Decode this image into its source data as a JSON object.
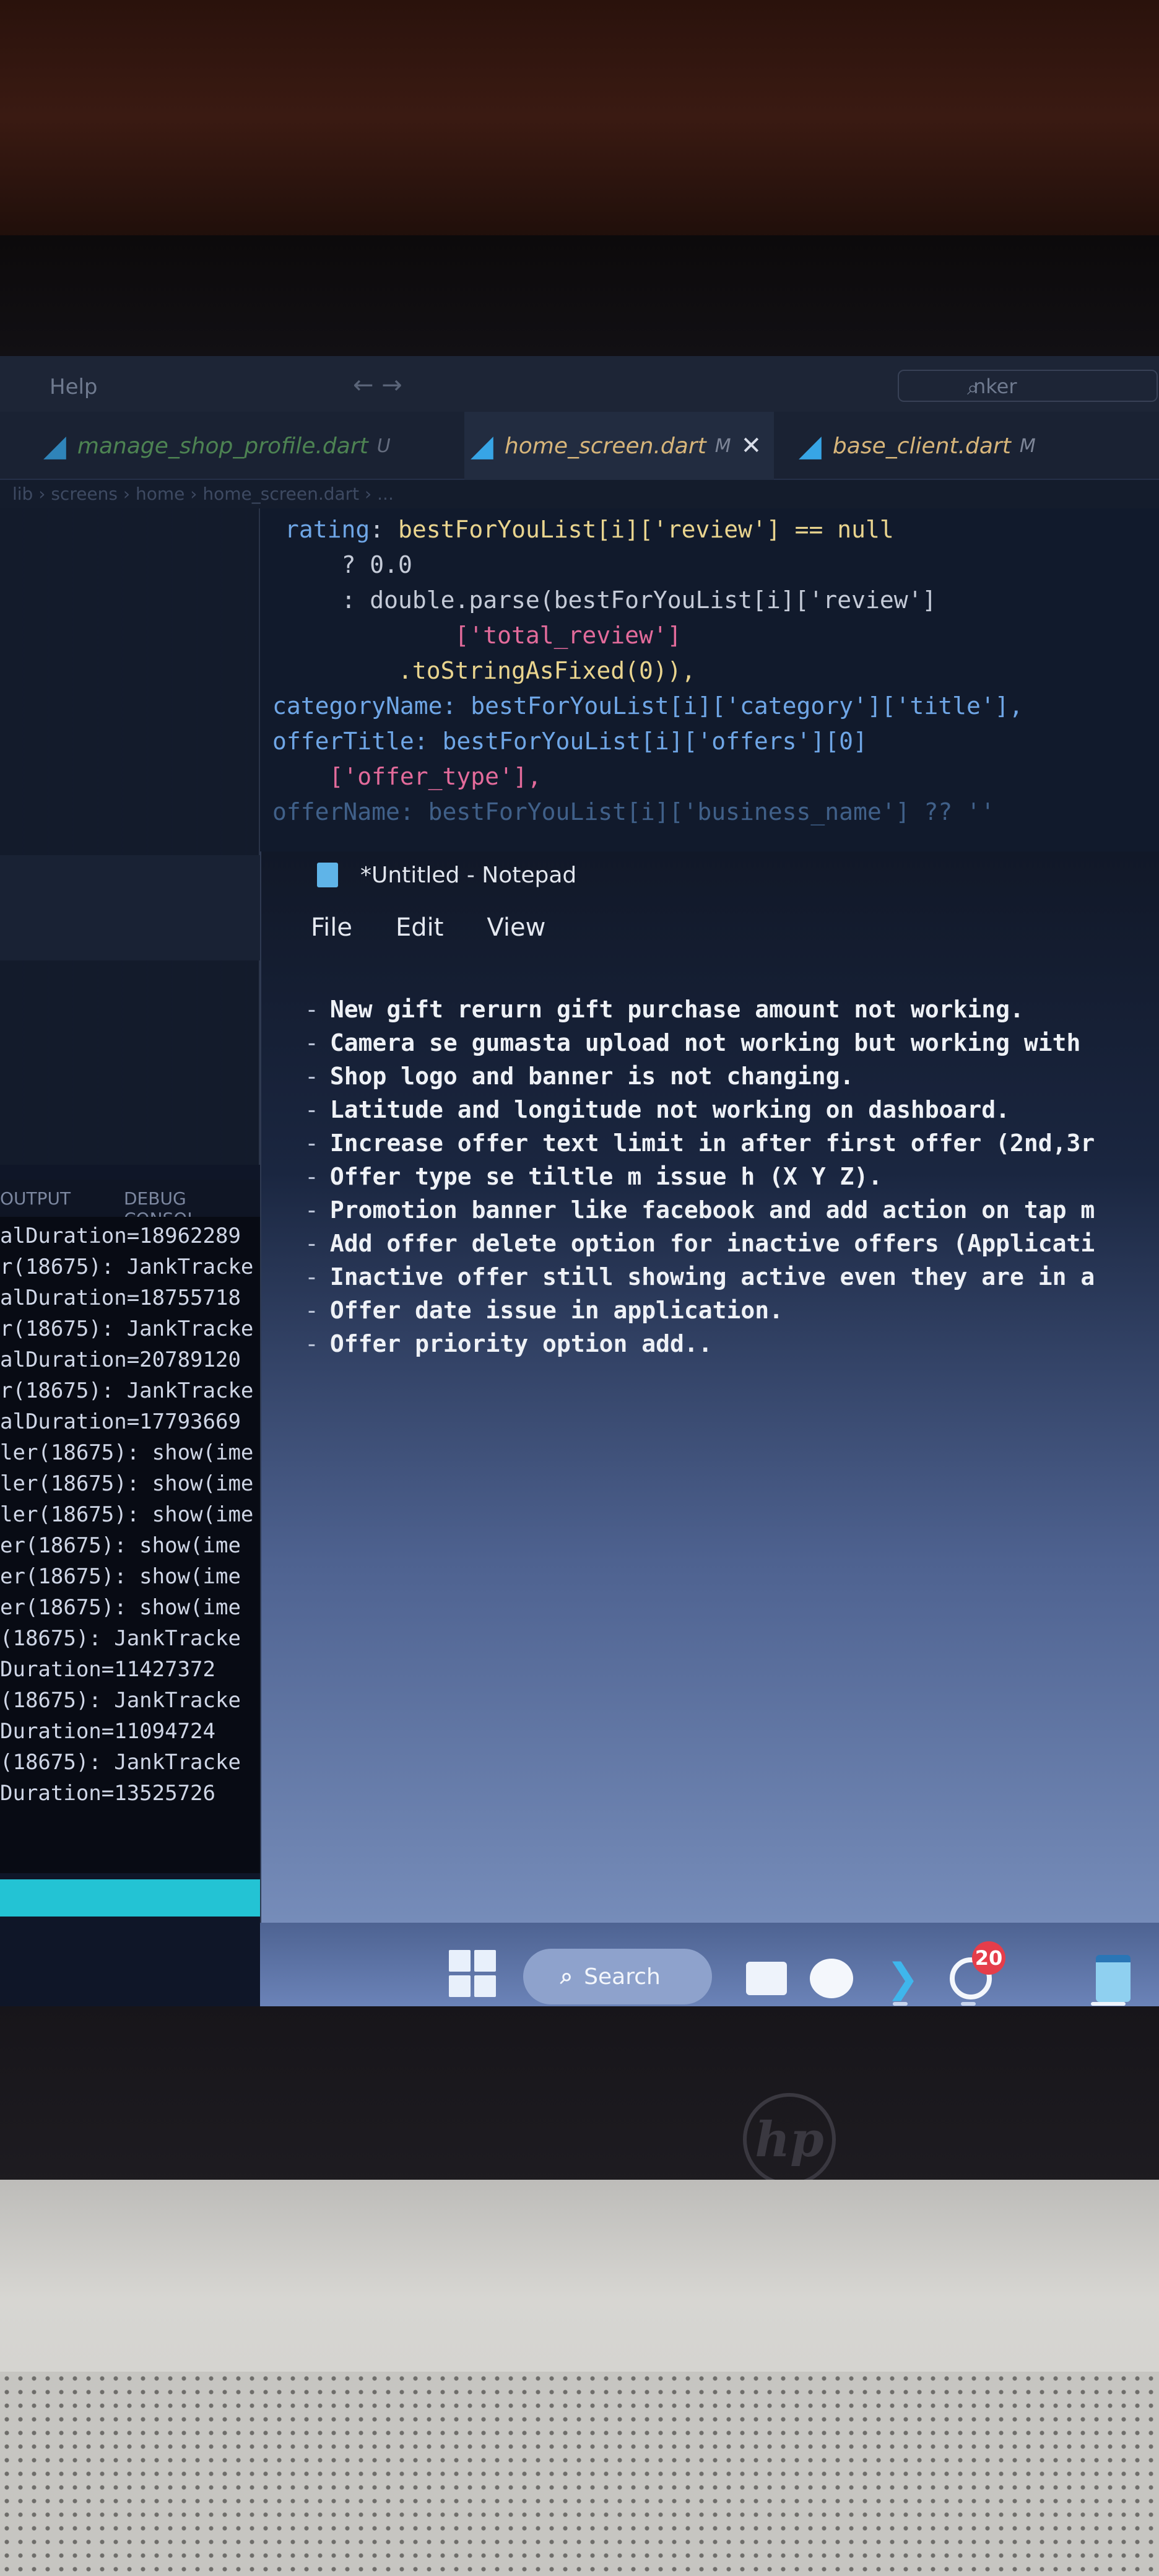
{
  "menubar": {
    "help": "Help",
    "nav": "← →",
    "search_icon": "search-icon",
    "search_placeholder": "nker"
  },
  "tabs": [
    {
      "label": "manage_shop_profile.dart",
      "mark": "U"
    },
    {
      "label": "home_screen.dart",
      "mark": "M",
      "close": "✕"
    },
    {
      "label": "base_client.dart",
      "mark": "M"
    }
  ],
  "breadcrumb": "lib › screens › home › home_screen.dart › ...",
  "editor": {
    "lines": [
      "rating: bestForYouList[i]['review'] == null",
      "    ? 0.0",
      "    : double.parse(bestForYouList[i]['review']",
      "            ['total_review']",
      "        .toStringAsFixed(0)),",
      "categoryName: bestForYouList[i]['category']['title'],",
      "offerTitle: bestForYouList[i]['offers'][0]",
      "    ['offer_type'],",
      "offerName: bestForYouList[i]['business_name'] ?? ''"
    ]
  },
  "panel": {
    "output_tab": "OUTPUT",
    "debug_tab": "DEBUG CONSOL"
  },
  "console": {
    "lines": [
      "alDuration=18962289",
      "r(18675): JankTracke",
      "alDuration=18755718",
      "r(18675): JankTracke",
      "alDuration=20789120",
      "r(18675): JankTracke",
      "alDuration=17793669",
      "ler(18675): show(ime",
      "ler(18675): show(ime",
      "ler(18675): show(ime",
      "er(18675): show(ime",
      "er(18675): show(ime",
      "er(18675): show(ime",
      "(18675): JankTracke",
      "Duration=11427372",
      "(18675): JankTracke",
      "Duration=11094724",
      "(18675): JankTracke",
      "Duration=13525726"
    ]
  },
  "notepad": {
    "title": "*Untitled - Notepad",
    "menu": {
      "file": "File",
      "edit": "Edit",
      "view": "View"
    },
    "bullet": "-",
    "items": [
      "New gift rerurn gift purchase amount not working.",
      "Camera se gumasta upload not working but working with",
      "Shop logo and banner is not changing.",
      "Latitude and longitude not working on dashboard.",
      "Increase offer text limit in after first offer (2nd,3r",
      "Offer type se tiltle m issue h (X Y Z).",
      "Promotion banner like facebook and add action on tap m",
      "Add offer delete option for inactive offers (Applicati",
      "Inactive offer still showing active even they are in a",
      "Offer date issue in application.",
      "Offer priority option add.."
    ]
  },
  "taskbar": {
    "search_label": "Search",
    "badge": "20"
  },
  "logo": "hp",
  "colors": {
    "accent_blue": "#37a5e6",
    "console_bg": "#080b14",
    "cyan_status": "#23c3d4",
    "badge_red": "#e53d4a"
  }
}
